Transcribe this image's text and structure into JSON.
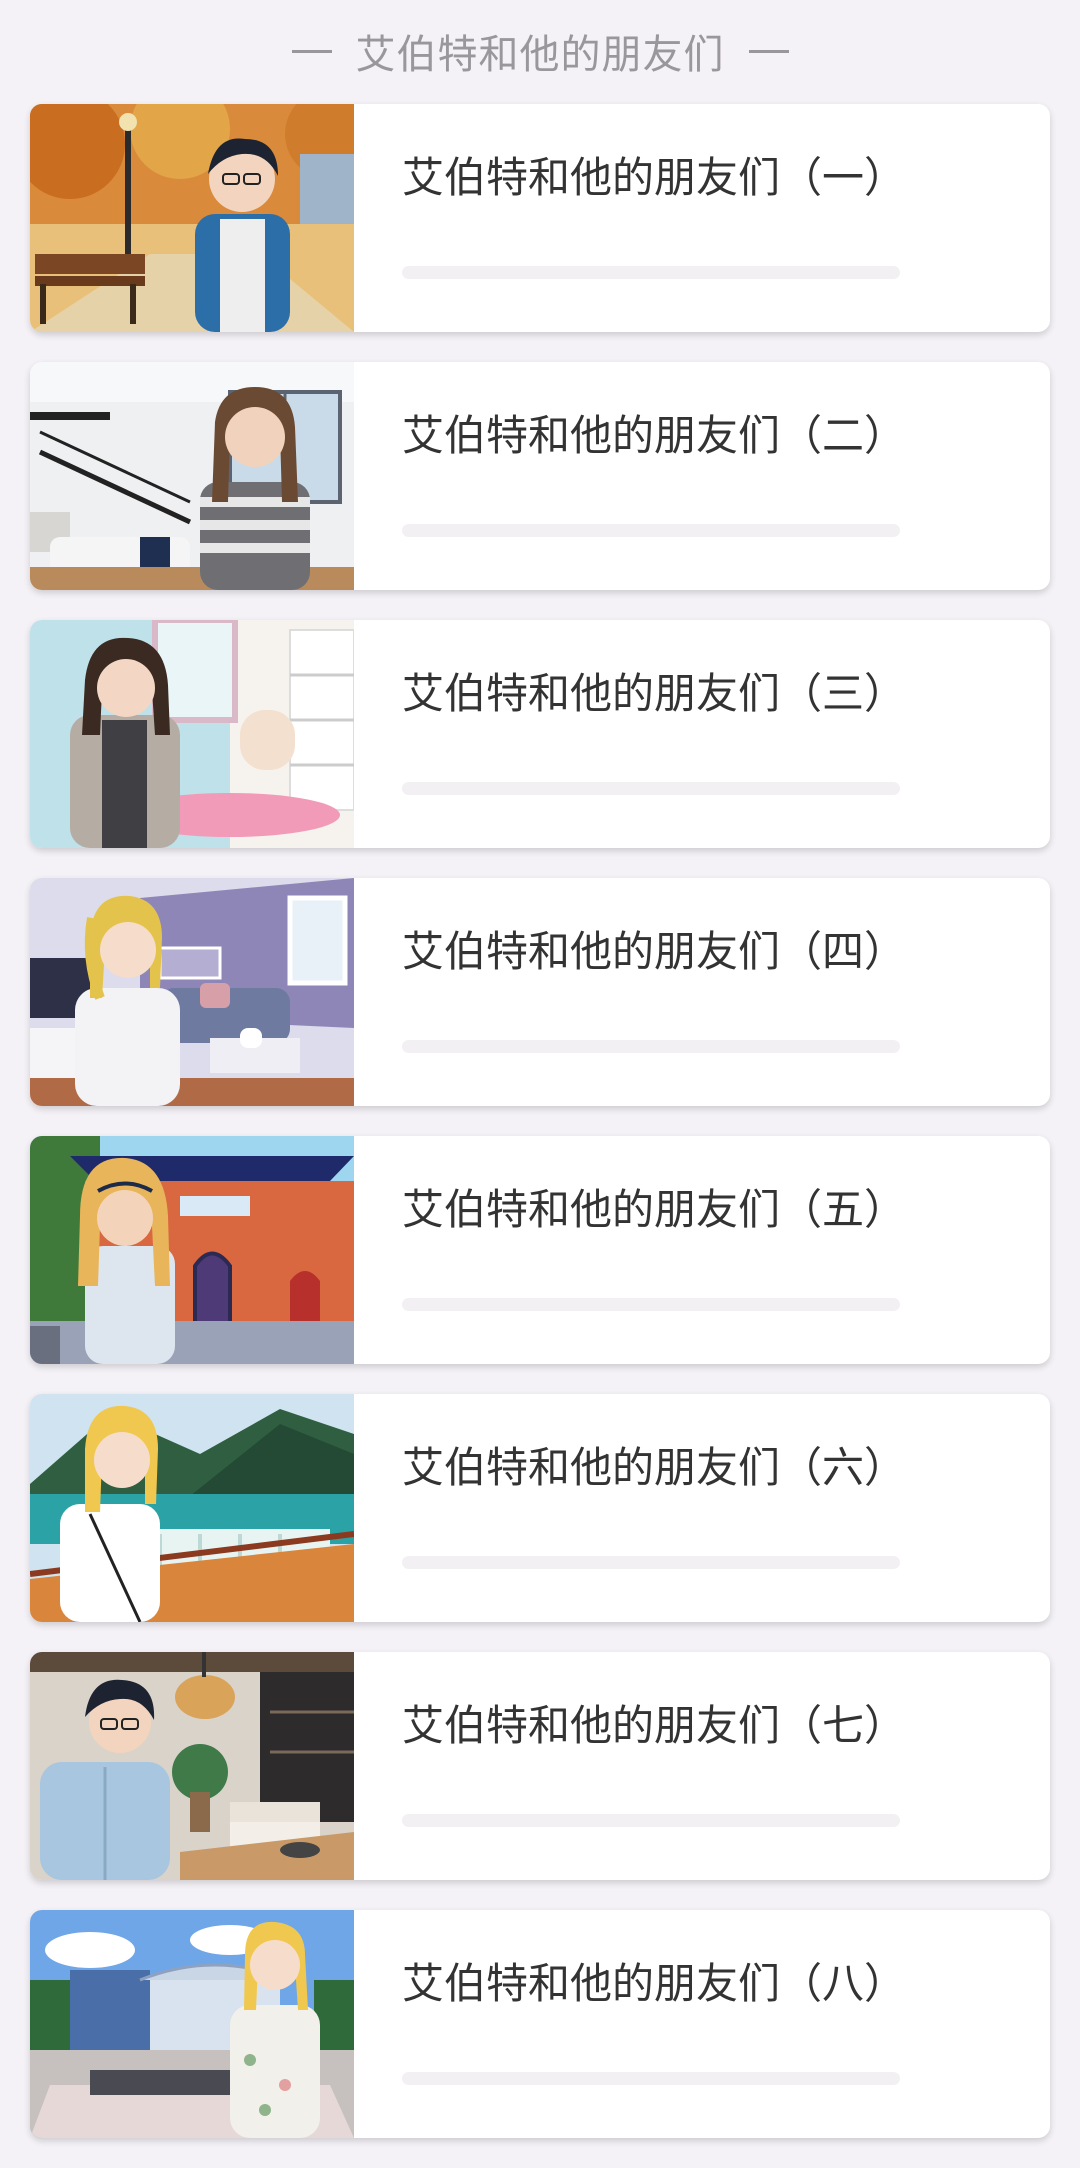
{
  "header": {
    "title": "艾伯特和他的朋友们"
  },
  "episodes": [
    {
      "title": "艾伯特和他的朋友们（一）",
      "progress": 0
    },
    {
      "title": "艾伯特和他的朋友们（二）",
      "progress": 0
    },
    {
      "title": "艾伯特和他的朋友们（三）",
      "progress": 0
    },
    {
      "title": "艾伯特和他的朋友们（四）",
      "progress": 0
    },
    {
      "title": "艾伯特和他的朋友们（五）",
      "progress": 0
    },
    {
      "title": "艾伯特和他的朋友们（六）",
      "progress": 0
    },
    {
      "title": "艾伯特和他的朋友们（七）",
      "progress": 0
    },
    {
      "title": "艾伯特和他的朋友们（八）",
      "progress": 0
    }
  ],
  "colors": {
    "background": "#f4f2f6",
    "card": "#ffffff",
    "progress_track": "#f3f0f4",
    "header_text": "#9a979c",
    "title_text": "#333333"
  }
}
